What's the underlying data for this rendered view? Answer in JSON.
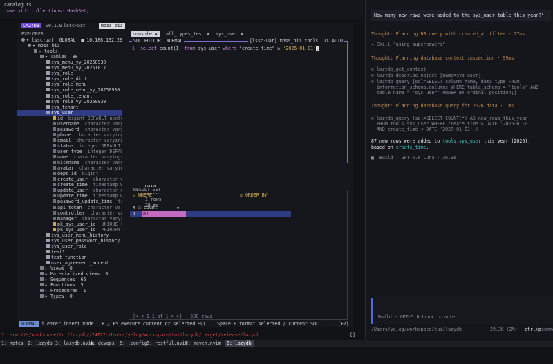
{
  "editor": {
    "filename": "catalog.rs",
    "code_line": "use std::collections::HashSet;"
  },
  "lazydb": {
    "badge": "LAZYDB",
    "version": "v0.1.0",
    "connection_tab": "lssc-uat",
    "schema_tab": "moss_biz",
    "explorer_title": "EXPLORER",
    "tree": [
      {
        "depth": 0,
        "text": "▾ lssc-uat  GLOBAL  ■ 10.188.132.29",
        "icon": "db"
      },
      {
        "depth": 1,
        "text": "▾ moss_biz",
        "icon": "db"
      },
      {
        "depth": 2,
        "text": "▾ tools",
        "icon": "folder"
      },
      {
        "depth": 3,
        "text": "▾ Tables  80",
        "icon": "folder"
      },
      {
        "depth": 4,
        "text": "sys_menu_yy_20250930",
        "icon": "table"
      },
      {
        "depth": 4,
        "text": "sys_menu_yy_20251017",
        "icon": "table"
      },
      {
        "depth": 4,
        "text": "sys_role",
        "icon": "table"
      },
      {
        "depth": 4,
        "text": "sys_role_dict",
        "icon": "table"
      },
      {
        "depth": 4,
        "text": "sys_role_menu",
        "icon": "table"
      },
      {
        "depth": 4,
        "text": "sys_role_menu_yy_20250930",
        "icon": "table"
      },
      {
        "depth": 4,
        "text": "sys_role_tenant",
        "icon": "table"
      },
      {
        "depth": 4,
        "text": "sys_role_yy_20250930",
        "icon": "table"
      },
      {
        "depth": 4,
        "text": "sys_tenant",
        "icon": "table"
      },
      {
        "depth": 4,
        "text": "sys_user",
        "icon": "table",
        "selected": true
      },
      {
        "depth": 5,
        "text": "id",
        "type": "  bigint DEFAULT nextv",
        "icon": "key"
      },
      {
        "depth": 5,
        "text": "username",
        "type": "  character varyi",
        "icon": "col"
      },
      {
        "depth": 5,
        "text": "password",
        "type": "  character varyi",
        "icon": "col"
      },
      {
        "depth": 5,
        "text": "phone",
        "type": "  character varying",
        "icon": "col"
      },
      {
        "depth": 5,
        "text": "email",
        "type": "  character varying",
        "icon": "col"
      },
      {
        "depth": 5,
        "text": "status",
        "type": "  integer DEFAULT",
        "icon": "col"
      },
      {
        "depth": 5,
        "text": "user_type",
        "type": "  integer DEFAU",
        "icon": "col"
      },
      {
        "depth": 5,
        "text": "name",
        "type": "  character varying(",
        "icon": "col"
      },
      {
        "depth": 5,
        "text": "nickname",
        "type": "  character varyi",
        "icon": "col"
      },
      {
        "depth": 5,
        "text": "avatar",
        "type": "  character varyin",
        "icon": "col"
      },
      {
        "depth": 5,
        "text": "dept_id",
        "type": "  bigint",
        "icon": "col"
      },
      {
        "depth": 5,
        "text": "create_user",
        "type": "  character v",
        "icon": "col"
      },
      {
        "depth": 5,
        "text": "create_time",
        "type": "  timestamp w",
        "icon": "col"
      },
      {
        "depth": 5,
        "text": "update_user",
        "type": "  character v",
        "icon": "col"
      },
      {
        "depth": 5,
        "text": "update_time",
        "type": "  timestamp w",
        "icon": "col"
      },
      {
        "depth": 5,
        "text": "password_update_time",
        "type": "  ti",
        "icon": "col"
      },
      {
        "depth": 5,
        "text": "api_token",
        "type": "  character va",
        "icon": "col"
      },
      {
        "depth": 5,
        "text": "controller",
        "type": "  character va",
        "icon": "col"
      },
      {
        "depth": 5,
        "text": "manager",
        "type": "  character varyi",
        "icon": "col"
      },
      {
        "depth": 5,
        "text": "pk_sys_user_id",
        "type": "  UNIQUE [",
        "icon": "key"
      },
      {
        "depth": 5,
        "text": "pk_sys_user_id",
        "type": "  PRIMARY",
        "icon": "key"
      },
      {
        "depth": 4,
        "text": "sys_user_menu_history",
        "icon": "table"
      },
      {
        "depth": 4,
        "text": "sys_user_password_history",
        "icon": "table"
      },
      {
        "depth": 4,
        "text": "sys_user_role",
        "icon": "table"
      },
      {
        "depth": 4,
        "text": "test1",
        "icon": "table"
      },
      {
        "depth": 4,
        "text": "test_function",
        "icon": "table"
      },
      {
        "depth": 4,
        "text": "user_agreement_accept",
        "icon": "table"
      },
      {
        "depth": 3,
        "text": "▸ Views  0",
        "icon": "folder"
      },
      {
        "depth": 3,
        "text": "▸ Materialized views  0",
        "icon": "folder"
      },
      {
        "depth": 3,
        "text": "▸ Sequences  65",
        "icon": "folder"
      },
      {
        "depth": 3,
        "text": "▸ Functions  5",
        "icon": "folder"
      },
      {
        "depth": 3,
        "text": "▸ Procedures  1",
        "icon": "folder"
      },
      {
        "depth": 3,
        "text": "▸ Types  0",
        "icon": "folder"
      }
    ],
    "main_tabs": [
      "console ✖",
      "all_types_test ✖",
      "sys_user ✖"
    ],
    "sql_editor_title": "SQL EDITOR  NORMAL",
    "sql_editor_right": "[lssc-uat] moss_biz.tools  TX AUTO",
    "sql": {
      "line_no": "1",
      "kw1": "select",
      "mid": " count(1) ",
      "kw2": "from",
      "mid2": " sys_user ",
      "kw3": "where",
      "mid3": " \"create_time\" ≥ ",
      "str": "'2026-01-01'",
      "cursor": ";"
    },
    "result_tabs": {
      "data": "DATA",
      "output": "OUTPUT",
      "rows": "1 rows",
      "ms": "39 ms"
    },
    "result_set_label": "RESULT SET",
    "where_label": "▽ WHERE",
    "orderby_label": "≡ ORDER BY",
    "grid_header": "# ☐ count       ◆",
    "grid_row_num": "1",
    "grid_row_value": "87",
    "pager": "|< < 1-1 of 1 > >|   500 rows",
    "mode": "NORMAL",
    "hint": "i enter insert mode   R / F5 execute current or selected SQL    Space F format selected / current SQL   ... (+2)"
  },
  "tmux": {
    "cmd": "7 term://~/workspace/tui/lazydb//24822:/Users/yelog/workspace/tui/lazydb/target/release/lazydb",
    "cursor_marker": "[]",
    "windows": [
      "1: notes",
      "2: lazydb",
      "3: lazydb.nvim",
      "4: devops",
      "5: .config",
      "6: restful.nvim",
      "7: maven.nvim",
      "8: lazydb"
    ]
  },
  "chat": {
    "question": "How many new rows were added to the sys_user table this year?\"",
    "lines": [
      {
        "cls": "thought",
        "text": "Thought: Planning DB query with created_at filter · 27ms"
      },
      {
        "cls": "muted",
        "text": "→ Skill \"using-superpowers\""
      },
      {
        "cls": "thought",
        "text": "Thought: Planning database context inspection · 99ms"
      },
      {
        "cls": "muted",
        "text": "⊙ lazydb_get_context"
      },
      {
        "cls": "muted",
        "text": "⊙ lazydb_describe_object [name=sys_user]"
      },
      {
        "cls": "muted",
        "text": "⊙ lazydb_query [sql=SELECT column_name, data_type FROM"
      },
      {
        "cls": "muted",
        "text": "  information_schema.columns WHERE table_schema = 'tools' AND"
      },
      {
        "cls": "muted",
        "text": "  table_name = 'sys_user' ORDER BY ordinal_position;]"
      },
      {
        "cls": "thought",
        "text": "Thought: Planning database query for 2026 data · 1ms"
      },
      {
        "cls": "muted",
        "text": "⊙ lazydb_query [sql=SELECT COUNT(*) AS new_rows_this_year"
      },
      {
        "cls": "muted",
        "text": "  FROM tools.sys_user WHERE create_time ≥ DATE '2026-01-01'"
      },
      {
        "cls": "muted",
        "text": "  AND create_time < DATE '2027-01-01';]"
      }
    ],
    "answer_a": "87 new rows were added to ",
    "answer_b": "tools.sys_user",
    "answer_c": " this year (2026),",
    "answer_d": "based on ",
    "answer_e": "create_time",
    "answer_f": ".",
    "build_line": "■  Build · GPT-5.6 Luna · 36.3s",
    "input_model": "Build · GPT-5.6 Luna  xrouter",
    "footer_path": "/Users/yelog/workspace/tui/lazydb",
    "footer_stats": "29.3K (2%)",
    "footer_cmd": "ctrl+p",
    "footer_cmd_label": " commands"
  }
}
